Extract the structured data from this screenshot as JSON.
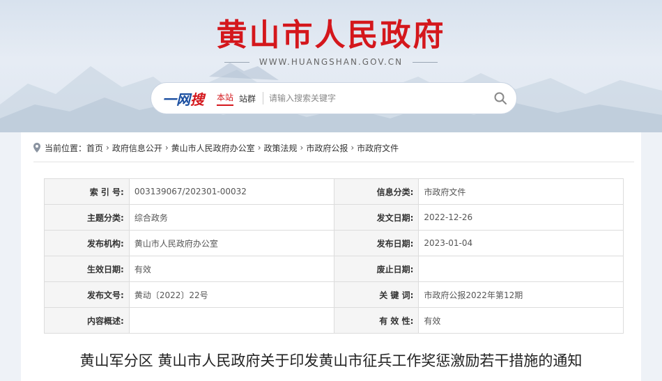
{
  "header": {
    "site_title": "黄山市人民政府",
    "site_url": "WWW.HUANGSHAN.GOV.CN"
  },
  "search": {
    "logo_prefix": "一网",
    "logo_highlight": "搜",
    "scope_this_site": "本站",
    "scope_site_group": "站群",
    "placeholder": "请输入搜索关键字"
  },
  "breadcrumb": {
    "prefix": "当前位置：",
    "items": [
      "首页",
      "政府信息公开",
      "黄山市人民政府办公室",
      "政策法规",
      "市政府公报",
      "市政府文件"
    ]
  },
  "meta": {
    "rows": [
      {
        "l1": "索 引 号:",
        "v1": "003139067/202301-00032",
        "l2": "信息分类:",
        "v2": "市政府文件"
      },
      {
        "l1": "主题分类:",
        "v1": "综合政务",
        "l2": "发文日期:",
        "v2": "2022-12-26"
      },
      {
        "l1": "发布机构:",
        "v1": "黄山市人民政府办公室",
        "l2": "发布日期:",
        "v2": "2023-01-04"
      },
      {
        "l1": "生效日期:",
        "v1": "有效",
        "l2": "废止日期:",
        "v2": ""
      },
      {
        "l1": "发布文号:",
        "v1": "黄动〔2022〕22号",
        "l2": "关 键 词:",
        "v2": "市政府公报2022年第12期"
      },
      {
        "l1": "内容概述:",
        "v1": "",
        "l2": "有 效 性:",
        "v2": "有效"
      }
    ]
  },
  "document": {
    "title": "黄山军分区  黄山市人民政府关于印发黄山市征兵工作奖惩激励若干措施的通知"
  },
  "colors": {
    "brand_red": "#d4171c",
    "logo_blue": "#1a4ea0"
  }
}
